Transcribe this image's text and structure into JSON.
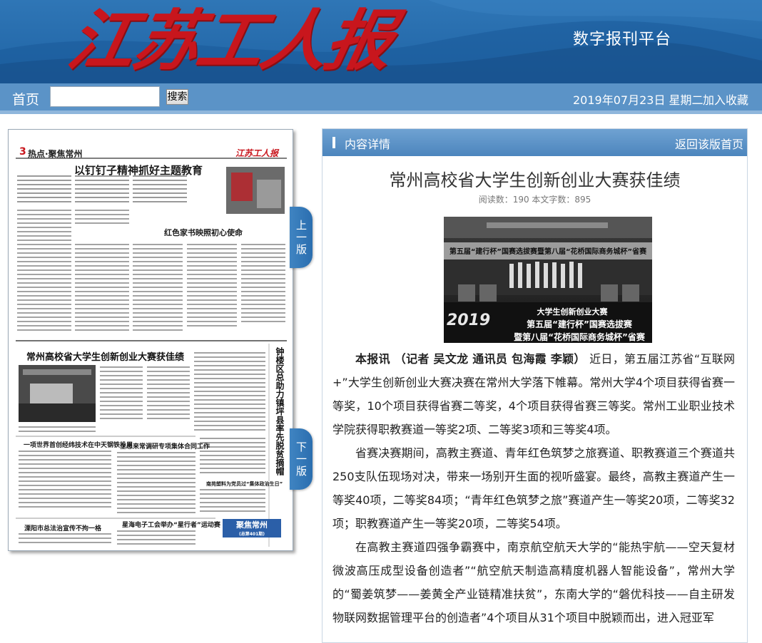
{
  "header": {
    "masthead": "江苏工人报",
    "platform_label": "数字报刊平台"
  },
  "navbar": {
    "home_label": "首页",
    "search_placeholder": "",
    "search_button": "搜索",
    "date": "2019年07月23日 星期二",
    "favorite_label": "加入收藏"
  },
  "paper_page": {
    "page_number": "3",
    "section": "热点·聚焦常州",
    "logo": "江苏工人报",
    "headlines": [
      "以钉钉子精神抓好主题教育",
      "红色家书映照初心使命",
      "常州高校省大学生创新创业大赛获佳绩",
      "一项世界首创经纬技术在中天钢铁投用",
      "全总来常调研专项集体合同工作",
      "溧阳市总法治宣传不拘一格",
      "星海电子工会举办“星行者”运动赛",
      "南苑塑料为党员过“集体政治生日”"
    ],
    "vertical_headline": "钟楼区总助力镇坪县率先脱贫摘帽",
    "badge_title": "聚焦常州",
    "badge_sub": "(总第401期)",
    "tab_prev": "上一版",
    "tab_next": "下一版"
  },
  "article": {
    "panel_title": "内容详情",
    "back_link": "返回该版首页",
    "title": "常州高校省大学生创新创业大赛获佳绩",
    "meta": "阅读数：190   本文字数：895",
    "photo_banner_top": "第五届“建行杯”国赛选拔赛暨第八届“花桥国际商务城杯”省赛",
    "photo_banner_bottom_1": "大学生创新创业大赛",
    "photo_banner_bottom_2": "第五届“建行杯”国赛选拔赛",
    "photo_banner_bottom_3": "暨第八届“花桥国际商务城杯”省赛",
    "photo_logo": "2019",
    "lead": "本报讯  （记者  吴文龙  通讯员  包海霞  李颖）",
    "paragraphs": [
      "近日，第五届江苏省“互联网+”大学生创新创业大赛决赛在常州大学落下帷幕。常州大学4个项目获得省赛一等奖，10个项目获得省赛二等奖，4个项目获得省赛三等奖。常州工业职业技术学院获得职教赛道一等奖2项、二等奖3项和三等奖4项。",
      "省赛决赛期间，高教主赛道、青年红色筑梦之旅赛道、职教赛道三个赛道共250支队伍现场对决，带来一场别开生面的视听盛宴。最终，高教主赛道产生一等奖40项，二等奖84项；“青年红色筑梦之旅”赛道产生一等奖20项，二等奖32项；职教赛道产生一等奖20项，二等奖54项。",
      "在高教主赛道四强争霸赛中，南京航空航天大学的“能热宇航——空天复材微波高压成型设备创造者”“航空航天制造高精度机器人智能设备”，常州大学的“蜀姜筑梦——姜黄全产业链精准扶贫”，东南大学的“磐优科技——自主研发物联网数据管理平台的创造者”4个项目从31个项目中脱颖而出，进入冠亚军"
    ]
  },
  "colors": {
    "header_blue": "#1f63a4",
    "nav_blue": "#5b93c7",
    "masthead_red": "#c8161d",
    "panel_header_blue": "#4c85bd"
  }
}
